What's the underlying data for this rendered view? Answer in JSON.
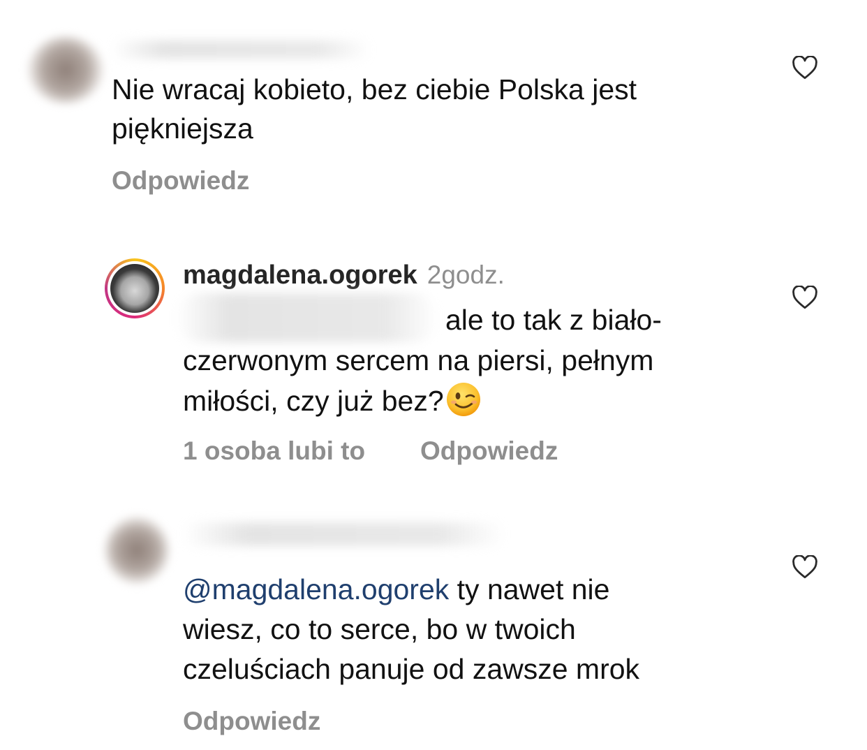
{
  "comments": [
    {
      "text_line1": "Nie wracaj kobieto, bez ciebie Polska jest",
      "text_line2": "piękniejsza",
      "reply_label": "Odpowiedz"
    },
    {
      "username": "magdalena.ogorek",
      "time": "2godz.",
      "text_line1": "ale to tak z biało-",
      "text_line2": "czerwonym sercem na piersi, pełnym",
      "text_line3": "miłości, czy już bez?",
      "likes_label": "1 osoba lubi to",
      "reply_label": "Odpowiedz",
      "emoji": "winking-face"
    },
    {
      "mention": "@magdalena.ogorek",
      "text_line1_rest": " ty nawet nie",
      "text_line2": "wiesz, co to serce, bo w twoich",
      "text_line3": "czeluściach panuje od zawsze mrok",
      "reply_label": "Odpowiedz"
    }
  ],
  "icons": {
    "like": "heart-outline-icon"
  },
  "colors": {
    "text": "#111111",
    "meta": "#8e8e8e",
    "mention": "#1f3f6e"
  }
}
